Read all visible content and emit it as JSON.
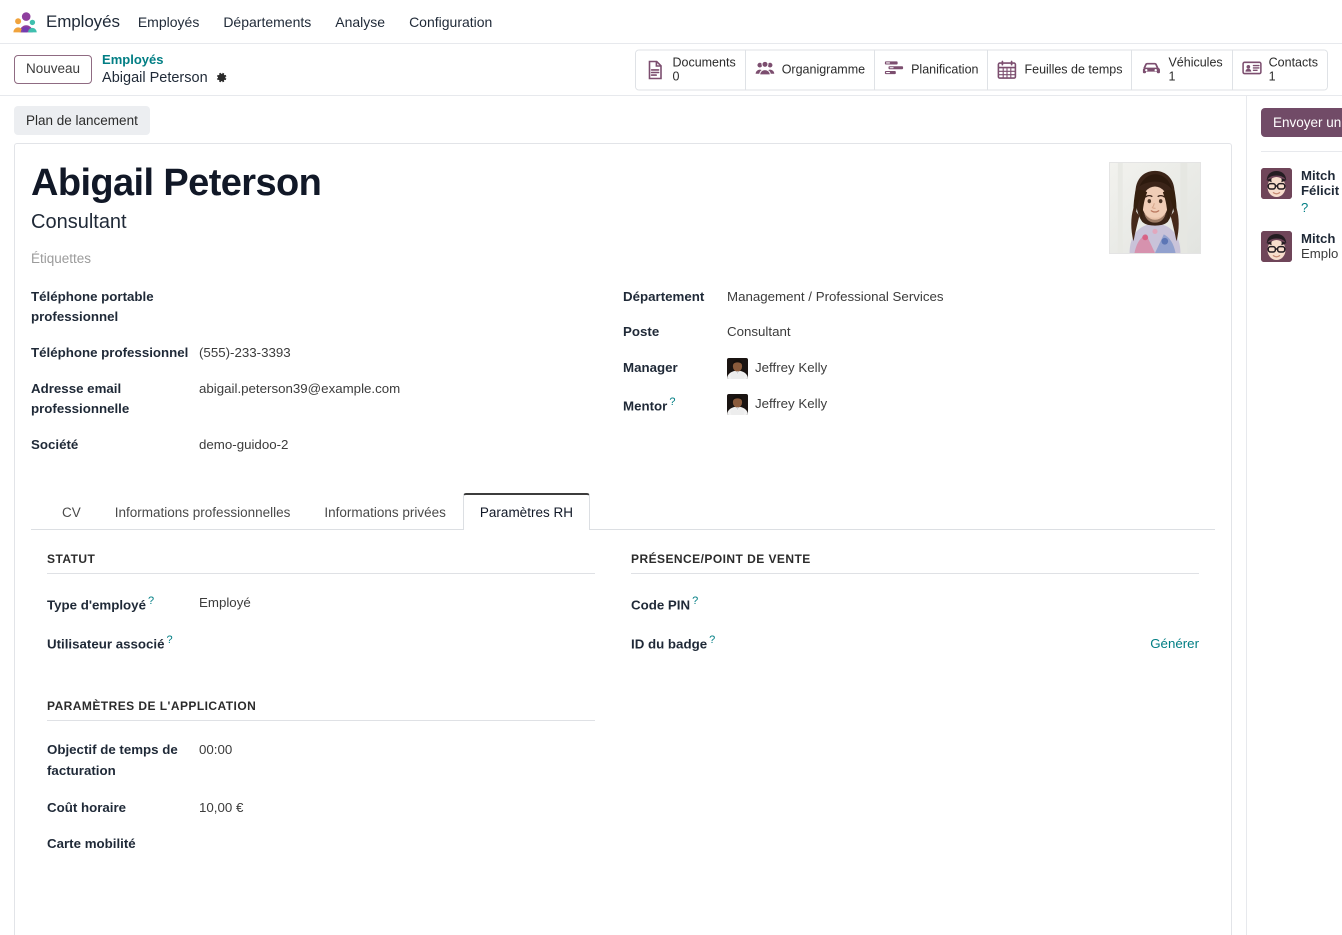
{
  "navbar": {
    "app_icon": "employees-app-icon",
    "app_name": "Employés",
    "menu_items": [
      {
        "label": "Employés",
        "name": "menu-employees"
      },
      {
        "label": "Départements",
        "name": "menu-departments"
      },
      {
        "label": "Analyse",
        "name": "menu-analysis"
      },
      {
        "label": "Configuration",
        "name": "menu-configuration"
      }
    ]
  },
  "control_panel": {
    "new_button": "Nouveau",
    "breadcrumb_parent": "Employés",
    "breadcrumb_current": "Abigail Peterson",
    "settings_icon": "gear-icon",
    "smart_buttons": [
      {
        "icon": "document-icon",
        "label": "Documents",
        "count": "0"
      },
      {
        "icon": "org-chart-icon",
        "label": "Organigramme",
        "count": ""
      },
      {
        "icon": "planning-icon",
        "label": "Planification",
        "count": ""
      },
      {
        "icon": "calendar-icon",
        "label": "Feuilles de temps",
        "count": ""
      },
      {
        "icon": "car-icon",
        "label": "Véhicules",
        "count": "1"
      },
      {
        "icon": "badge-icon",
        "label": "Contacts",
        "count": "1"
      }
    ]
  },
  "statusbar": {
    "launch_plan_button": "Plan de lancement"
  },
  "record": {
    "name": "Abigail Peterson",
    "job_title": "Consultant",
    "tags_placeholder": "Étiquettes",
    "avatar": "employee-photo",
    "left_fields": [
      {
        "label": "Téléphone portable professionnel",
        "value": "",
        "name": "field-mobile-phone"
      },
      {
        "label": "Téléphone professionnel",
        "value": "(555)-233-3393",
        "name": "field-work-phone"
      },
      {
        "label": "Adresse email professionnelle",
        "value": "abigail.peterson39@example.com",
        "name": "field-work-email"
      },
      {
        "label": "Société",
        "value": "demo-guidoo-2",
        "name": "field-company"
      }
    ],
    "right_fields": [
      {
        "label": "Département",
        "value": "Management / Professional Services",
        "name": "field-department",
        "avatar": false,
        "help": false
      },
      {
        "label": "Poste",
        "value": "Consultant",
        "name": "field-job-position",
        "avatar": false,
        "help": false
      },
      {
        "label": "Manager",
        "value": "Jeffrey Kelly",
        "name": "field-manager",
        "avatar": true,
        "help": false
      },
      {
        "label": "Mentor",
        "value": "Jeffrey Kelly",
        "name": "field-coach",
        "avatar": true,
        "help": true
      }
    ]
  },
  "notebook": {
    "tabs": [
      {
        "label": "CV",
        "name": "tab-resume",
        "active": false
      },
      {
        "label": "Informations professionnelles",
        "name": "tab-work-information",
        "active": false
      },
      {
        "label": "Informations privées",
        "name": "tab-private-information",
        "active": false
      },
      {
        "label": "Paramètres RH",
        "name": "tab-hr-settings",
        "active": true
      }
    ],
    "hr_settings": {
      "left_groups": [
        {
          "title": "STATUT",
          "name": "group-status",
          "fields": [
            {
              "label": "Type d'employé",
              "value": "Employé",
              "help": true,
              "name": "field-employee-type"
            },
            {
              "label": "Utilisateur associé",
              "value": "",
              "help": true,
              "name": "field-related-user"
            }
          ]
        },
        {
          "title": "PARAMÈTRES DE L'APPLICATION",
          "name": "group-application-settings",
          "fields": [
            {
              "label": "Objectif de temps de facturation",
              "value": "00:00",
              "help": false,
              "name": "field-billable-time-target"
            },
            {
              "label": "Coût horaire",
              "value": "10,00 €",
              "help": false,
              "name": "field-hourly-cost"
            },
            {
              "label": "Carte mobilité",
              "value": "",
              "help": false,
              "name": "field-mobility-card"
            }
          ]
        }
      ],
      "right_groups": [
        {
          "title": "PRÉSENCE/POINT DE VENTE",
          "name": "group-attendance-pos",
          "fields": [
            {
              "label": "Code PIN",
              "value": "",
              "help": true,
              "action": "",
              "name": "field-pin-code"
            },
            {
              "label": "ID du badge",
              "value": "",
              "help": true,
              "action": "Générer",
              "name": "field-badge-id"
            }
          ]
        }
      ]
    }
  },
  "chatter": {
    "send_button": "Envoyer un",
    "messages": [
      {
        "author": "Mitch",
        "subject": "Félicit",
        "extra": "?",
        "name": "chatter-message"
      },
      {
        "author": "Mitch",
        "subject": "Emplo",
        "extra": "",
        "name": "chatter-message"
      }
    ]
  },
  "colors": {
    "brand_primary": "#714B67",
    "link_teal": "#017E84",
    "icon_purple": "#7C4E6F",
    "text_dark": "#111827"
  }
}
